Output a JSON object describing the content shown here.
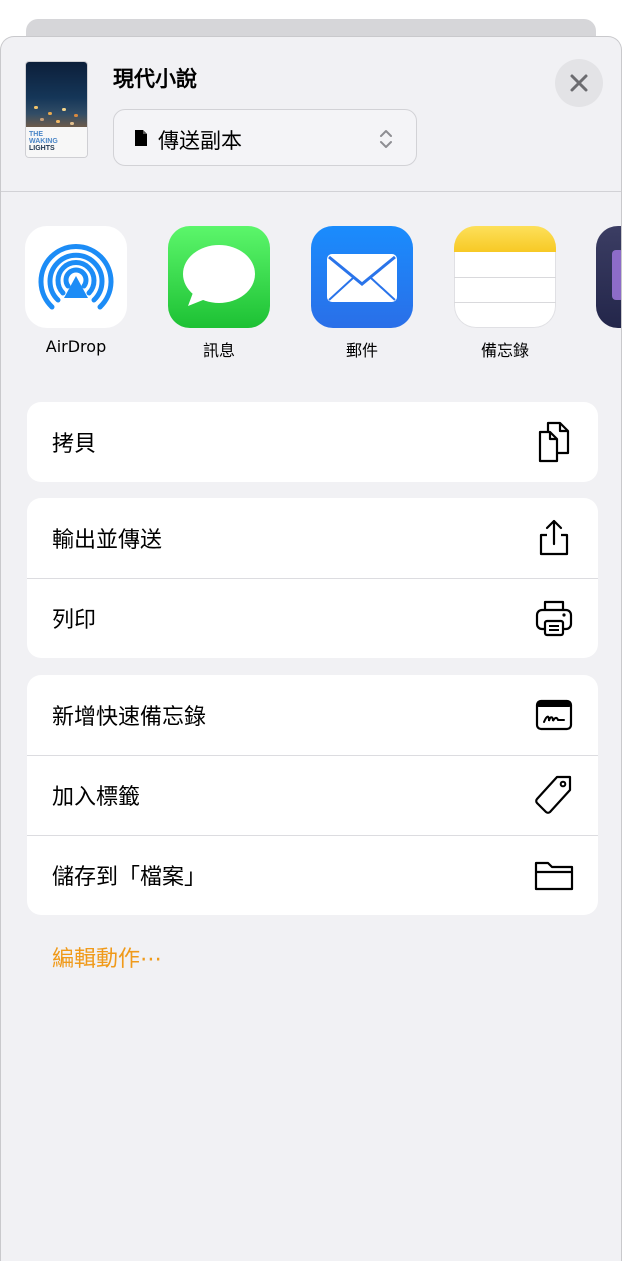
{
  "document": {
    "title": "現代小說",
    "thumbnail_text": [
      "THE",
      "WAKING",
      "LIGHTS"
    ],
    "send_mode": "傳送副本"
  },
  "close_icon": "close-icon",
  "apps": [
    {
      "label": "AirDrop",
      "icon": "airdrop-icon"
    },
    {
      "label": "訊息",
      "icon": "messages-icon"
    },
    {
      "label": "郵件",
      "icon": "mail-icon"
    },
    {
      "label": "備忘錄",
      "icon": "notes-icon"
    }
  ],
  "action_groups": [
    [
      {
        "label": "拷貝",
        "icon": "copy-icon"
      }
    ],
    [
      {
        "label": "輸出並傳送",
        "icon": "share-icon"
      },
      {
        "label": "列印",
        "icon": "printer-icon"
      }
    ],
    [
      {
        "label": "新增快速備忘錄",
        "icon": "quick-note-icon"
      },
      {
        "label": "加入標籤",
        "icon": "tag-icon"
      },
      {
        "label": "儲存到「檔案」",
        "icon": "folder-icon"
      }
    ]
  ],
  "edit_actions_label": "編輯動作⋯",
  "colors": {
    "accent": "#f09a1a",
    "sheet_background": "#f1f1f4",
    "row_background": "#ffffff"
  }
}
